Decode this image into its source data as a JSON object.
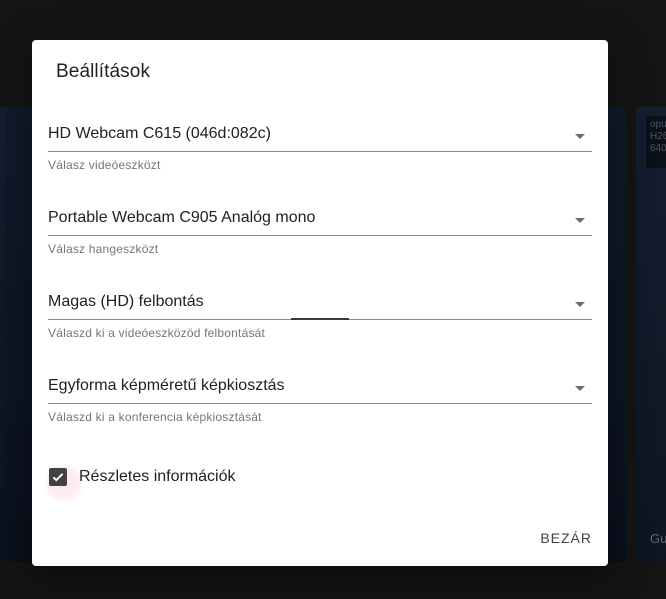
{
  "background": {
    "info_text": "opu\nH26\n640",
    "participant_name": "Gu"
  },
  "dialog": {
    "title": "Beállítások",
    "video_device": {
      "value": "HD Webcam C615 (046d:082c)",
      "helper": "Válasz videóeszközt"
    },
    "audio_device": {
      "value": "Portable Webcam C905 Analóg mono",
      "helper": "Válasz hangeszközt"
    },
    "resolution": {
      "value": "Magas (HD) felbontás",
      "helper": "Válaszd ki a videóeszközöd felbontását"
    },
    "layout": {
      "value": "Egyforma képméretű képkiosztás",
      "helper": "Válaszd ki a konferencia képkiosztását"
    },
    "details_checkbox": {
      "label": "Részletes információk",
      "checked": true
    },
    "close_label": "BEZÁR"
  },
  "colors": {
    "accent_ripple": "#e91e63",
    "checkbox": "#424242"
  }
}
